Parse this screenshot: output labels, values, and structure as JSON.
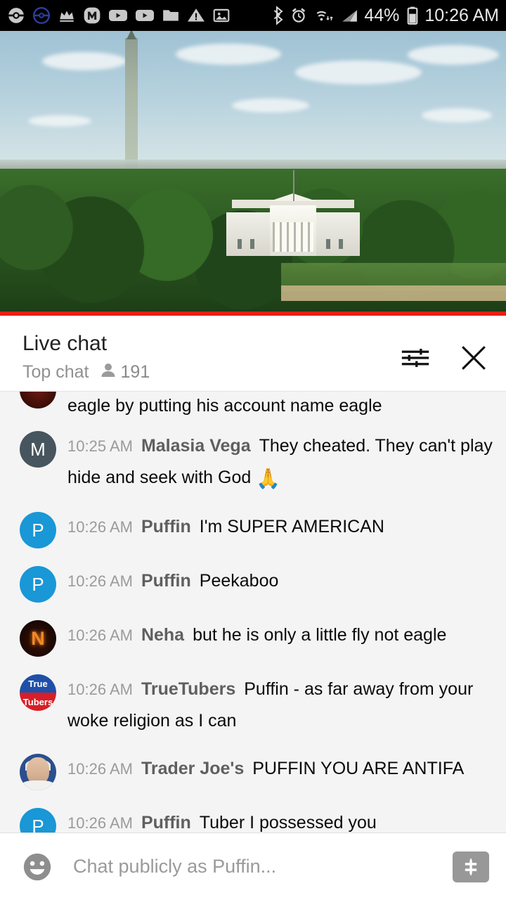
{
  "status_bar": {
    "notification_icons": [
      "pokeball-icon",
      "pokeball-outline-icon",
      "crown-icon",
      "m-app-icon",
      "youtube-icon",
      "youtube-icon-2",
      "folder-icon",
      "warning-triangle-icon",
      "image-icon"
    ],
    "system_icons": [
      "bluetooth-icon",
      "alarm-icon",
      "wifi-icon",
      "signal-icon",
      "battery-icon"
    ],
    "battery_percent": "44%",
    "time": "10:26 AM"
  },
  "video": {
    "name": "live-stream-white-house",
    "progress_color": "#e62117"
  },
  "chat_header": {
    "title": "Live chat",
    "mode": "Top chat",
    "viewer_count": "191",
    "settings_icon": "chat-settings-icon",
    "close_icon": "close-icon"
  },
  "messages": [
    {
      "partial": true,
      "avatar_type": "dark-red",
      "avatar_letter": "",
      "time": "",
      "author": "",
      "text": "eagle by putting his account name eagle"
    },
    {
      "partial": false,
      "avatar_type": "m",
      "avatar_letter": "M",
      "time": "10:25 AM",
      "author": "Malasia Vega",
      "text": "They cheated. They can't play hide and seek with God ",
      "emoji": "🙏"
    },
    {
      "partial": false,
      "avatar_type": "p",
      "avatar_letter": "P",
      "time": "10:26 AM",
      "author": "Puffin",
      "text": "I'm SUPER AMERICAN"
    },
    {
      "partial": false,
      "avatar_type": "p",
      "avatar_letter": "P",
      "time": "10:26 AM",
      "author": "Puffin",
      "text": "Peekaboo"
    },
    {
      "partial": false,
      "avatar_type": "n",
      "avatar_letter": "N",
      "time": "10:26 AM",
      "author": "Neha",
      "text": "but he is only a little fly not eagle"
    },
    {
      "partial": false,
      "avatar_type": "tt",
      "avatar_letter": "",
      "avatar_top_text": "True",
      "avatar_bottom_text": "Tubers",
      "time": "10:26 AM",
      "author": "TrueTubers",
      "text": "Puffin - as far away from your woke religion as I can"
    },
    {
      "partial": false,
      "avatar_type": "photo",
      "avatar_letter": "",
      "time": "10:26 AM",
      "author": "Trader Joe's",
      "text": "PUFFIN YOU ARE ANTIFA"
    },
    {
      "partial": false,
      "avatar_type": "p",
      "avatar_letter": "P",
      "time": "10:26 AM",
      "author": "Puffin",
      "text": "Tuber I possessed you"
    }
  ],
  "input_bar": {
    "emoji_icon": "emoji-face-icon",
    "placeholder": "Chat publicly as Puffin...",
    "value": "",
    "superchat_icon": "dollar-sign-icon"
  }
}
